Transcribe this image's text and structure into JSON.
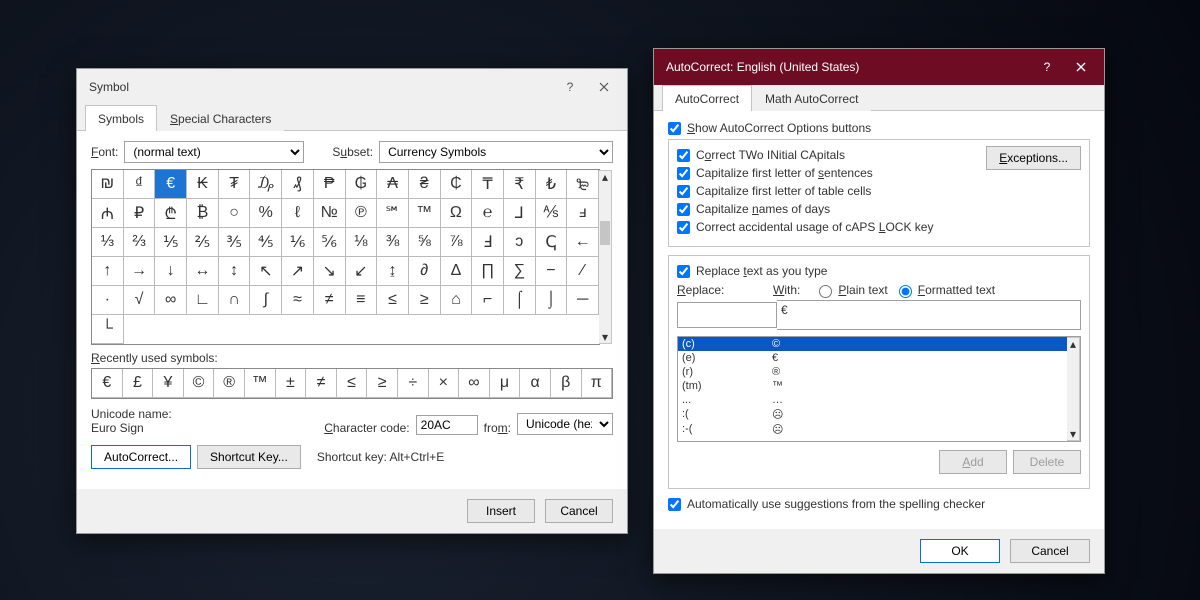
{
  "symbol": {
    "title": "Symbol",
    "tabs": [
      "Symbols",
      "Special Characters"
    ],
    "font_label": "Font:",
    "font_value": "(normal text)",
    "subset_label": "Subset:",
    "subset_value": "Currency Symbols",
    "grid": [
      "₪",
      "₫",
      "€",
      "₭",
      "₮",
      "₯",
      "₰",
      "₱",
      "₲",
      "₳",
      "₴",
      "₵",
      "₸",
      "₹",
      "₺",
      "₻",
      "₼",
      "₽",
      "₾",
      "₿",
      "○",
      "%",
      "ℓ",
      "№",
      "℗",
      "℠",
      "™",
      "Ω",
      "℮",
      "⅃",
      "⅍",
      "ⅎ",
      "⅓",
      "⅔",
      "⅕",
      "⅖",
      "⅗",
      "⅘",
      "⅙",
      "⅚",
      "⅛",
      "⅜",
      "⅝",
      "⅞",
      "Ⅎ",
      "ↄ",
      "ↅ",
      "←",
      "↑",
      "→",
      "↓",
      "↔",
      "↕",
      "↖",
      "↗",
      "↘",
      "↙",
      "↨",
      "∂",
      "Δ",
      "∏",
      "∑",
      "−",
      "∕",
      "∙",
      "√",
      "∞",
      "∟",
      "∩",
      "∫",
      "≈",
      "≠",
      "≡",
      "≤",
      "≥",
      "⌂",
      "⌐",
      "⌠",
      "⌡",
      "─",
      "└"
    ],
    "selected_index": 2,
    "recent_label": "Recently used symbols:",
    "recent": [
      "€",
      "£",
      "¥",
      "©",
      "®",
      "™",
      "±",
      "≠",
      "≤",
      "≥",
      "÷",
      "×",
      "∞",
      "μ",
      "α",
      "β",
      "π"
    ],
    "uname_label": "Unicode name:",
    "uname_value": "Euro Sign",
    "cc_label": "Character code:",
    "cc_value": "20AC",
    "from_label": "from:",
    "from_value": "Unicode (hex)",
    "ac_btn": "AutoCorrect...",
    "sk_btn": "Shortcut Key...",
    "sk_text": "Shortcut key: Alt+Ctrl+E",
    "insert": "Insert",
    "cancel": "Cancel"
  },
  "auto": {
    "title": "AutoCorrect: English (United States)",
    "tabs": [
      "AutoCorrect",
      "Math AutoCorrect"
    ],
    "opts": [
      "Show AutoCorrect Options buttons",
      "Correct TWo INitial CApitals",
      "Capitalize first letter of sentences",
      "Capitalize first letter of table cells",
      "Capitalize names of days",
      "Correct accidental usage of cAPS LOCK key"
    ],
    "exceptions": "Exceptions...",
    "replace_chk": "Replace text as you type",
    "replace_label": "Replace:",
    "with_label": "With:",
    "plain": "Plain text",
    "formatted": "Formatted text",
    "replace_val": "",
    "with_val": "€",
    "list": [
      [
        "(c)",
        "©"
      ],
      [
        "(e)",
        "€"
      ],
      [
        "(r)",
        "®"
      ],
      [
        "(tm)",
        "™"
      ],
      [
        "...",
        "…"
      ],
      [
        ":(",
        "☹"
      ],
      [
        ":-(",
        "☹"
      ]
    ],
    "list_sel": 0,
    "spell_chk": "Automatically use suggestions from the spelling checker",
    "add": "Add",
    "delete": "Delete",
    "ok": "OK",
    "cancel": "Cancel"
  }
}
